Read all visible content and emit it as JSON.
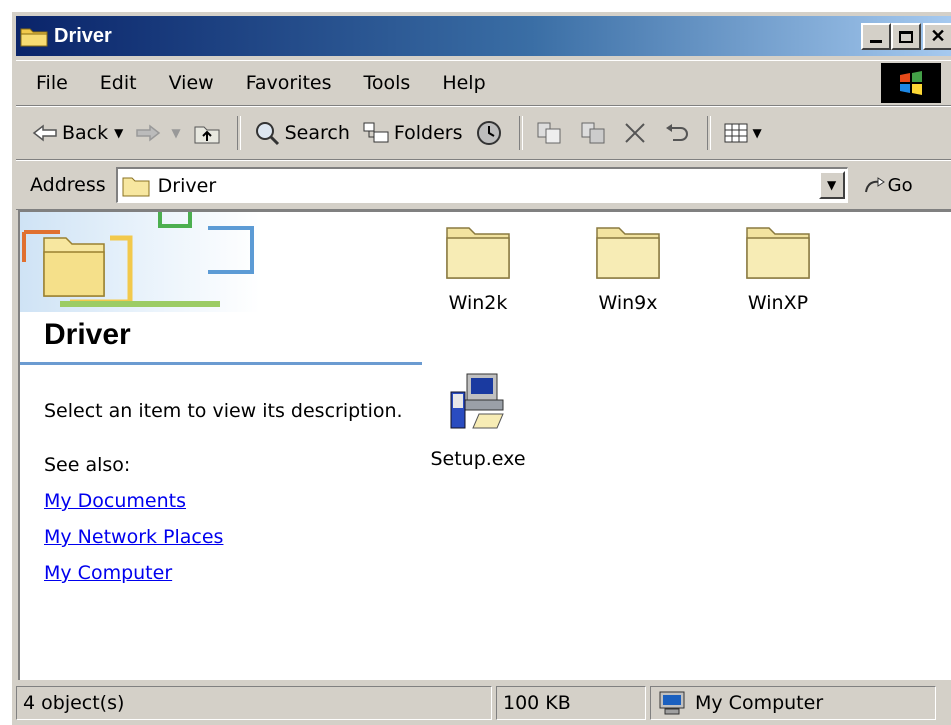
{
  "window": {
    "title": "Driver"
  },
  "menu": [
    "File",
    "Edit",
    "View",
    "Favorites",
    "Tools",
    "Help"
  ],
  "toolbar": {
    "back": "Back",
    "search": "Search",
    "folders": "Folders"
  },
  "address": {
    "label": "Address",
    "value": "Driver",
    "go": "Go"
  },
  "left_pane": {
    "title": "Driver",
    "description": "Select an item to view its description.",
    "see_also": "See also:",
    "links": [
      "My Documents",
      "My Network Places",
      "My Computer"
    ]
  },
  "items": [
    {
      "label": "Win2k",
      "icon": "folder-icon"
    },
    {
      "label": "Win9x",
      "icon": "folder-icon"
    },
    {
      "label": "WinXP",
      "icon": "folder-icon"
    },
    {
      "label": "Setup.exe",
      "icon": "setup-icon"
    }
  ],
  "status": {
    "objects": "4 object(s)",
    "size": "100 KB",
    "zone": "My Computer"
  },
  "colors": {
    "title_start": "#0a246a",
    "title_end": "#a6caf0",
    "link": "#0000ee",
    "pane_line": "#6b9bd1",
    "folder": "#f7e7a0"
  }
}
